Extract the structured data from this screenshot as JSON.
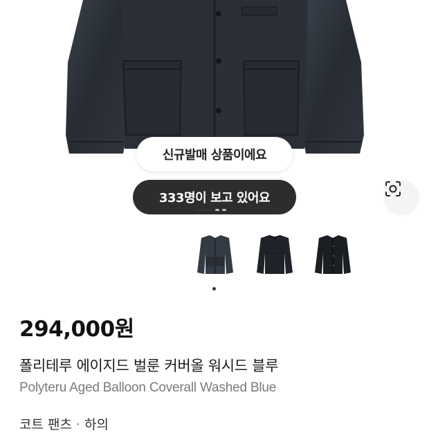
{
  "hero": {
    "badge_new": "신규발매 상품이에요",
    "badge_viewers": "333명이 보고 있어요",
    "lens_icon": "lens-search-icon",
    "carousel_pages": 3,
    "carousel_active": 1
  },
  "thumbnails": [
    {
      "name": "thumbnail-front",
      "selected": true
    },
    {
      "name": "thumbnail-back",
      "selected": false
    },
    {
      "name": "thumbnail-side",
      "selected": false
    }
  ],
  "product": {
    "price": "294,000원",
    "name_ko": "폴리테루 에이지드 벌룬 커버올 워시드 블루",
    "name_en": "Polyteru Aged Balloon Coverall Washed Blue"
  },
  "category": {
    "primary": "코트 팬츠",
    "separator": "·",
    "secondary": "하의"
  },
  "colors": {
    "jacket": "#2b3038",
    "pill_dark": "#2d2d2d"
  }
}
